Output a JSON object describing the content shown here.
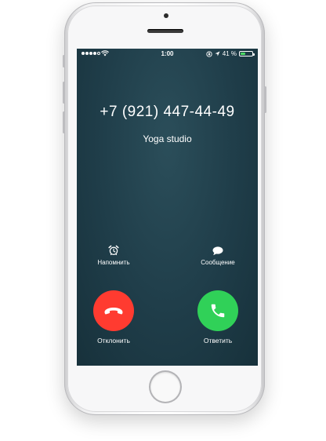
{
  "status_bar": {
    "time": "1:00",
    "battery_text": "41 %",
    "battery_level": 0.41,
    "signal_bars": 4,
    "icons": [
      "signal-dots-icon",
      "wifi-icon",
      "lock-rotation-icon",
      "location-arrow-icon",
      "battery-icon"
    ]
  },
  "call": {
    "number": "+7 (921) 447-44-49",
    "caller_label": "Yoga studio"
  },
  "options": {
    "remind_label": "Напомнить",
    "message_label": "Сообщение"
  },
  "actions": {
    "decline_label": "Отклонить",
    "accept_label": "Ответить"
  },
  "colors": {
    "decline": "#ff3b30",
    "accept": "#30d158",
    "screen_background": "#1f3d49"
  }
}
